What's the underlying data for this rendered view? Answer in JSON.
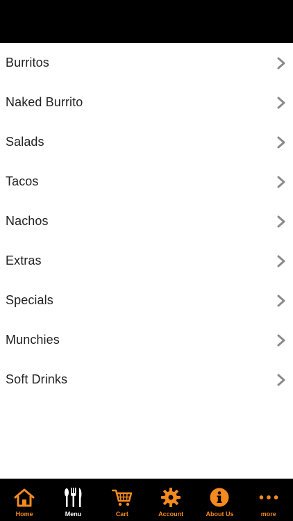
{
  "menu": {
    "items": [
      {
        "label": "Burritos"
      },
      {
        "label": "Naked Burrito"
      },
      {
        "label": "Salads"
      },
      {
        "label": "Tacos"
      },
      {
        "label": "Nachos"
      },
      {
        "label": "Extras"
      },
      {
        "label": "Specials"
      },
      {
        "label": "Munchies"
      },
      {
        "label": "Soft Drinks"
      }
    ],
    "chevron_icon": "chevron-right-icon",
    "chevron_color": "#8a8a8a"
  },
  "tabbar": {
    "accent_color": "#f58a1f",
    "active_color": "#ffffff",
    "tabs": [
      {
        "label": "Home",
        "icon": "home-icon",
        "active": false
      },
      {
        "label": "Menu",
        "icon": "fork-knife-icon",
        "active": true
      },
      {
        "label": "Cart",
        "icon": "cart-icon",
        "active": false
      },
      {
        "label": "Account",
        "icon": "gear-icon",
        "active": false
      },
      {
        "label": "About Us",
        "icon": "info-icon",
        "active": false
      },
      {
        "label": "more",
        "icon": "more-dots-icon",
        "active": false
      }
    ]
  }
}
